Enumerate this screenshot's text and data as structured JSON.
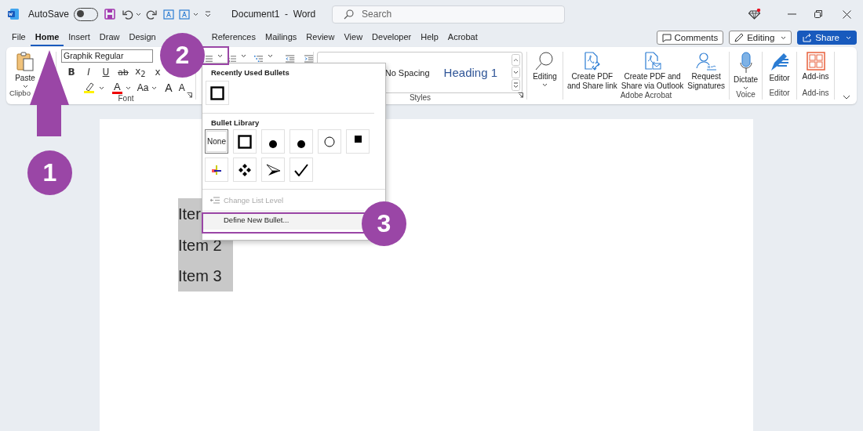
{
  "title_bar": {
    "autosave_label": "AutoSave",
    "autosave_on": false,
    "document_title": "Document1  -  Word",
    "search_placeholder": "Search"
  },
  "tabs": [
    {
      "label": "File",
      "selected": false
    },
    {
      "label": "Home",
      "selected": true
    },
    {
      "label": "Insert",
      "selected": false
    },
    {
      "label": "Draw",
      "selected": false
    },
    {
      "label": "Design",
      "selected": false
    },
    {
      "label": "References",
      "selected": false
    },
    {
      "label": "Mailings",
      "selected": false
    },
    {
      "label": "Review",
      "selected": false
    },
    {
      "label": "View",
      "selected": false
    },
    {
      "label": "Developer",
      "selected": false
    },
    {
      "label": "Help",
      "selected": false
    },
    {
      "label": "Acrobat",
      "selected": false
    }
  ],
  "header_buttons": [
    {
      "label": "Comments",
      "kind": "comments"
    },
    {
      "label": "Editing",
      "kind": "mode"
    },
    {
      "label": "Share",
      "kind": "share"
    }
  ],
  "ribbon": {
    "clipboard": {
      "paste": "Paste",
      "label": "Clipbo"
    },
    "font": {
      "font_name": "Graphik Regular",
      "format_buttons": [
        {
          "text": "B",
          "kind": "bold"
        },
        {
          "text": "I",
          "kind": "italic"
        },
        {
          "text": "U",
          "kind": "underline"
        },
        {
          "text": "ab",
          "kind": "strike"
        },
        {
          "text": "x$_{2}$",
          "kind": "subscript"
        },
        {
          "text": "x",
          "kind": "plain"
        }
      ],
      "color_button": "A",
      "case_button": "Aa",
      "grow_button": "A",
      "shrink_button": "A",
      "label": "Font"
    },
    "styles": {
      "items": [
        {
          "label": "No Spacing",
          "kind": "body"
        },
        {
          "label": "Heading 1",
          "kind": "heading"
        }
      ],
      "label": "Styles"
    },
    "editing": {
      "label": "Editing"
    },
    "acrobat": {
      "buttons": [
        {
          "lines": [
            "Create PDF",
            "and Share link"
          ],
          "kind": "link"
        },
        {
          "lines": [
            "Create PDF and",
            "Share via Outlook"
          ],
          "kind": "mail"
        },
        {
          "lines": [
            "Request",
            "Signatures"
          ],
          "kind": "sign"
        }
      ],
      "label": "Adobe Acrobat"
    },
    "voice": {
      "button": "Dictate",
      "label": "Voice"
    },
    "editor": {
      "button": "Editor",
      "label": "Editor"
    },
    "addins": {
      "button": "Add-ins",
      "label": "Add-ins"
    }
  },
  "bullets_menu": {
    "recent_heading": "Recently Used Bullets",
    "recent": [
      {
        "kind": "square",
        "selected": false
      }
    ],
    "library_heading": "Bullet Library",
    "library": [
      {
        "kind": "none",
        "label": "None",
        "selected": true
      },
      {
        "kind": "square",
        "selected": false
      },
      {
        "kind": "dot",
        "selected": false
      },
      {
        "kind": "dot",
        "selected": false
      },
      {
        "kind": "circle",
        "selected": false
      },
      {
        "kind": "small-square",
        "selected": false
      },
      {
        "kind": "color-cross",
        "selected": false
      },
      {
        "kind": "diamonds",
        "selected": false
      },
      {
        "kind": "arrowhead",
        "selected": false
      },
      {
        "kind": "check",
        "selected": false
      }
    ],
    "items": [
      {
        "label": "Change List Level",
        "disabled": true,
        "highlighted": false
      },
      {
        "label": "Define New Bullet...",
        "disabled": false,
        "highlighted": true
      }
    ]
  },
  "document": {
    "lines": [
      "Iter",
      "Item 2",
      "Item 3"
    ],
    "selected": true
  },
  "callouts": [
    {
      "number": "1",
      "kind": "arrow"
    },
    {
      "number": "2",
      "kind": "box"
    },
    {
      "number": "3",
      "kind": "box"
    }
  ]
}
